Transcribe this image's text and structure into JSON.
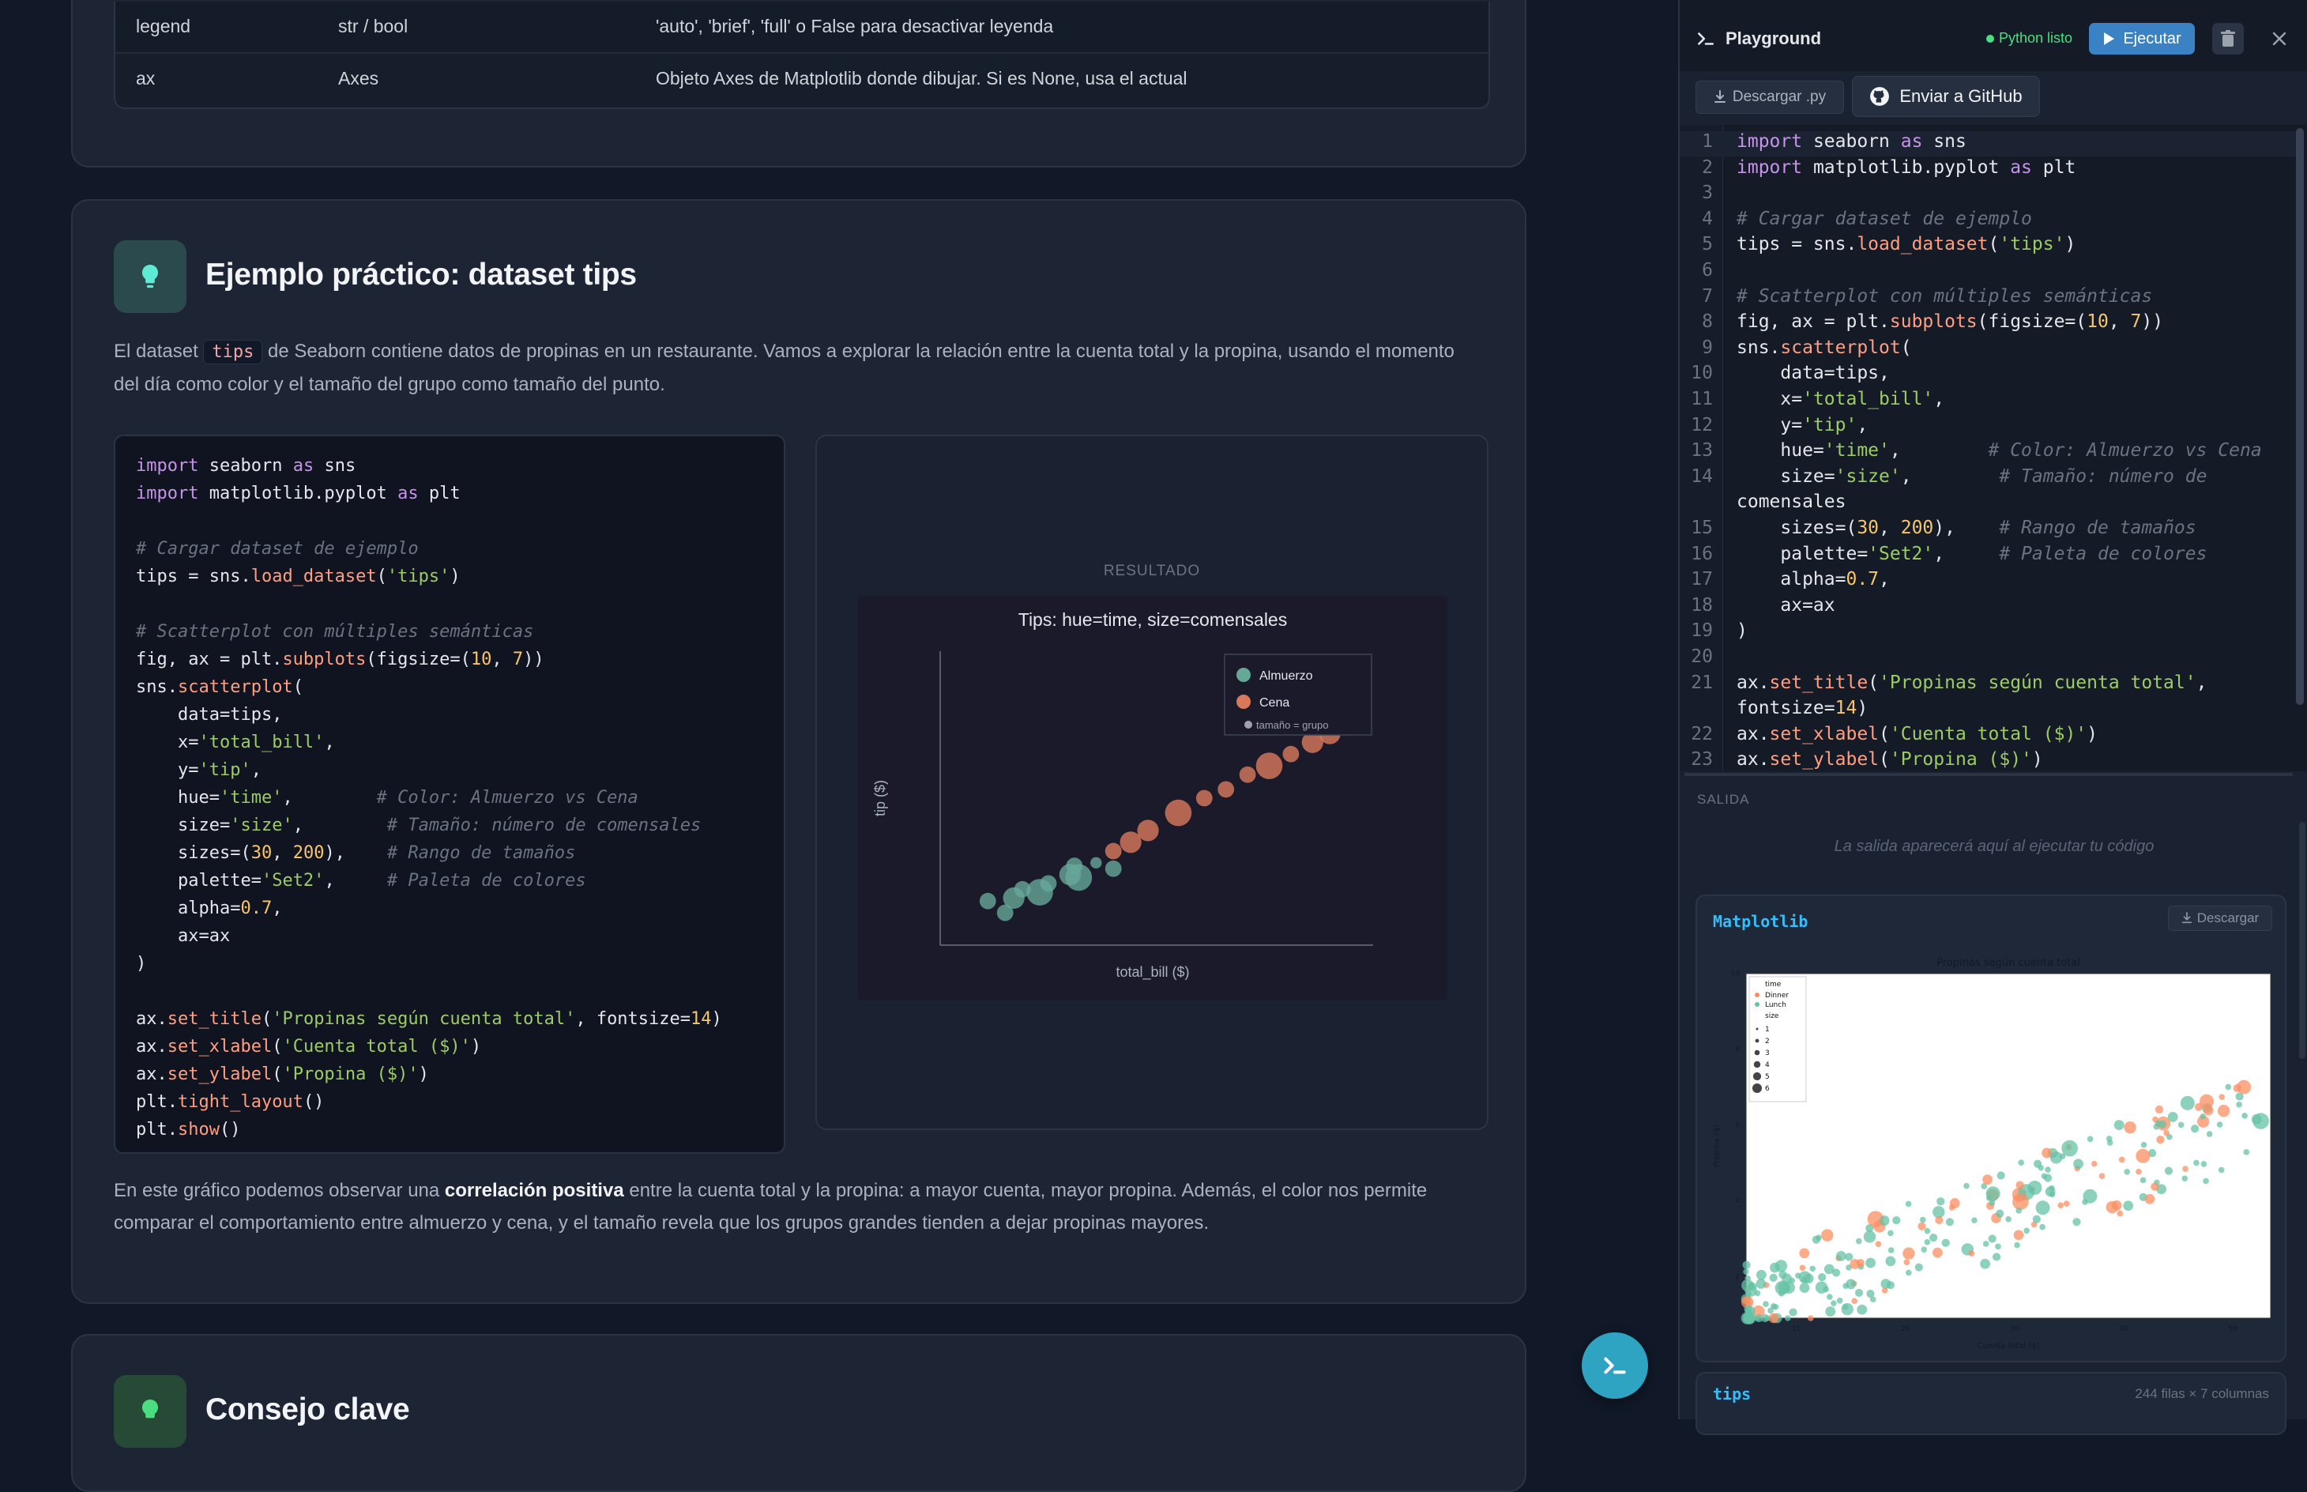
{
  "params_table": {
    "rows": [
      {
        "name": "legend",
        "type": "str / bool",
        "desc": "'auto', 'brief', 'full' o False para desactivar leyenda"
      },
      {
        "name": "ax",
        "type": "Axes",
        "desc": "Objeto Axes de Matplotlib donde dibujar. Si es None, usa el actual"
      }
    ]
  },
  "example": {
    "title": "Ejemplo práctico: dataset tips",
    "intro_before": "El dataset ",
    "intro_code": "tips",
    "intro_line1_after": " de Seaborn contiene datos de propinas en un restaurante. Vamos a explorar la relación entre la cuenta total y la propina, usando el momento",
    "intro_line2": "del día como color y el tamaño del grupo como tamaño del punto.",
    "result_label": "RESULTADO",
    "outro_before": "En este gráfico podemos observar una ",
    "outro_bold": "correlación positiva",
    "outro_line1_after": " entre la cuenta total y la propina: a mayor cuenta, mayor propina. Además, el color nos permite",
    "outro_line2": "comparar el comportamiento entre almuerzo y cena, y el tamaño revela que los grupos grandes tienden a dejar propinas mayores."
  },
  "next_section": {
    "title": "Consejo clave"
  },
  "chart_data": {
    "type": "scatter",
    "title": "Tips: hue=time, size=comensales",
    "xlabel": "total_bill ($)",
    "ylabel": "tip ($)",
    "legend_placement": "top-right",
    "legend": [
      "Almuerzo",
      "Cena"
    ],
    "size_legend": "tamaño = grupo",
    "grid": false,
    "series": [
      {
        "name": "Almuerzo",
        "color": "#66a898",
        "points": [
          [
            0.11,
            0.15
          ],
          [
            0.15,
            0.11
          ],
          [
            0.17,
            0.16
          ],
          [
            0.19,
            0.19
          ],
          [
            0.23,
            0.18
          ],
          [
            0.25,
            0.21
          ],
          [
            0.36,
            0.28
          ],
          [
            0.4,
            0.26
          ],
          [
            0.3,
            0.24
          ],
          [
            0.31,
            0.27
          ],
          [
            0.32,
            0.23
          ]
        ],
        "sizes": [
          2,
          2,
          3,
          2,
          4,
          2,
          1,
          2,
          3,
          2,
          4
        ]
      },
      {
        "name": "Cena",
        "color": "#d9795c",
        "points": [
          [
            0.4,
            0.32
          ],
          [
            0.44,
            0.35
          ],
          [
            0.48,
            0.39
          ],
          [
            0.55,
            0.45
          ],
          [
            0.61,
            0.5
          ],
          [
            0.66,
            0.53
          ],
          [
            0.71,
            0.58
          ],
          [
            0.76,
            0.61
          ],
          [
            0.81,
            0.65
          ],
          [
            0.86,
            0.69
          ],
          [
            0.9,
            0.72
          ],
          [
            0.94,
            0.76
          ]
        ],
        "sizes": [
          2,
          3,
          3,
          4,
          2,
          2,
          2,
          4,
          2,
          3,
          3,
          4
        ]
      }
    ]
  },
  "code_sample": [
    "import seaborn as sns",
    "import matplotlib.pyplot as plt",
    "",
    "# Cargar dataset de ejemplo",
    "tips = sns.load_dataset('tips')",
    "",
    "# Scatterplot con múltiples semánticas",
    "fig, ax = plt.subplots(figsize=(10, 7))",
    "sns.scatterplot(",
    "    data=tips,",
    "    x='total_bill',",
    "    y='tip',",
    "    hue='time',        # Color: Almuerzo vs Cena",
    "    size='size',        # Tamaño: número de comensales",
    "    sizes=(30, 200),    # Rango de tamaños",
    "    palette='Set2',     # Paleta de colores",
    "    alpha=0.7,",
    "    ax=ax",
    ")",
    "",
    "ax.set_title('Propinas según cuenta total', fontsize=14)",
    "ax.set_xlabel('Cuenta total ($)')",
    "ax.set_ylabel('Propina ($)')",
    "plt.tight_layout()",
    "plt.show()"
  ],
  "playground": {
    "title": "Playground",
    "status": "Python listo",
    "run_label": "Ejecutar",
    "download_py_label": "Descargar .py",
    "github_label": "Enviar a GitHub",
    "editor_lines": [
      {
        "n": "1",
        "t": "import seaborn as sns"
      },
      {
        "n": "2",
        "t": "import matplotlib.pyplot as plt"
      },
      {
        "n": "3",
        "t": ""
      },
      {
        "n": "4",
        "t": "# Cargar dataset de ejemplo"
      },
      {
        "n": "5",
        "t": "tips = sns.load_dataset('tips')"
      },
      {
        "n": "6",
        "t": ""
      },
      {
        "n": "7",
        "t": "# Scatterplot con múltiples semánticas"
      },
      {
        "n": "8",
        "t": "fig, ax = plt.subplots(figsize=(10, 7))"
      },
      {
        "n": "9",
        "t": "sns.scatterplot("
      },
      {
        "n": "10",
        "t": "    data=tips,"
      },
      {
        "n": "11",
        "t": "    x='total_bill',"
      },
      {
        "n": "12",
        "t": "    y='tip',"
      },
      {
        "n": "13",
        "t": "    hue='time',        # Color: Almuerzo vs Cena"
      },
      {
        "n": "14",
        "t": "    size='size',        # Tamaño: número de"
      },
      {
        "n": "",
        "t": "comensales"
      },
      {
        "n": "15",
        "t": "    sizes=(30, 200),    # Rango de tamaños"
      },
      {
        "n": "16",
        "t": "    palette='Set2',     # Paleta de colores"
      },
      {
        "n": "17",
        "t": "    alpha=0.7,"
      },
      {
        "n": "18",
        "t": "    ax=ax"
      },
      {
        "n": "19",
        "t": ")"
      },
      {
        "n": "20",
        "t": ""
      },
      {
        "n": "21",
        "t": "ax.set_title('Propinas según cuenta total',"
      },
      {
        "n": "",
        "t": "fontsize=14)"
      },
      {
        "n": "22",
        "t": "ax.set_xlabel('Cuenta total ($)')"
      },
      {
        "n": "23",
        "t": "ax.set_ylabel('Propina ($)')"
      }
    ],
    "output_label": "SALIDA",
    "output_placeholder": "La salida aparecerá aquí al ejecutar tu código",
    "matplotlib_title": "Matplotlib",
    "matplotlib_download": "Descargar",
    "tips_title": "tips",
    "tips_meta": "244 filas × 7 columnas"
  },
  "output_chart": {
    "title": "Propinas según cuenta total",
    "xlabel": "Cuenta total ($)",
    "ylabel": "Propina ($)",
    "legend_hue_title": "time",
    "legend_hue": [
      "Dinner",
      "Lunch"
    ],
    "legend_size_title": "size",
    "legend_sizes": [
      "1",
      "2",
      "3",
      "4",
      "5",
      "6"
    ],
    "xticks": [
      "10",
      "20",
      "30",
      "40",
      "50"
    ],
    "yticks": [
      "2",
      "4",
      "6",
      "8",
      "10"
    ]
  },
  "colors": {
    "accent": "#3b82c4",
    "lunch": "#66c2a5",
    "dinner": "#fc8d62",
    "status": "#4ade80",
    "link": "#38bdf8"
  }
}
